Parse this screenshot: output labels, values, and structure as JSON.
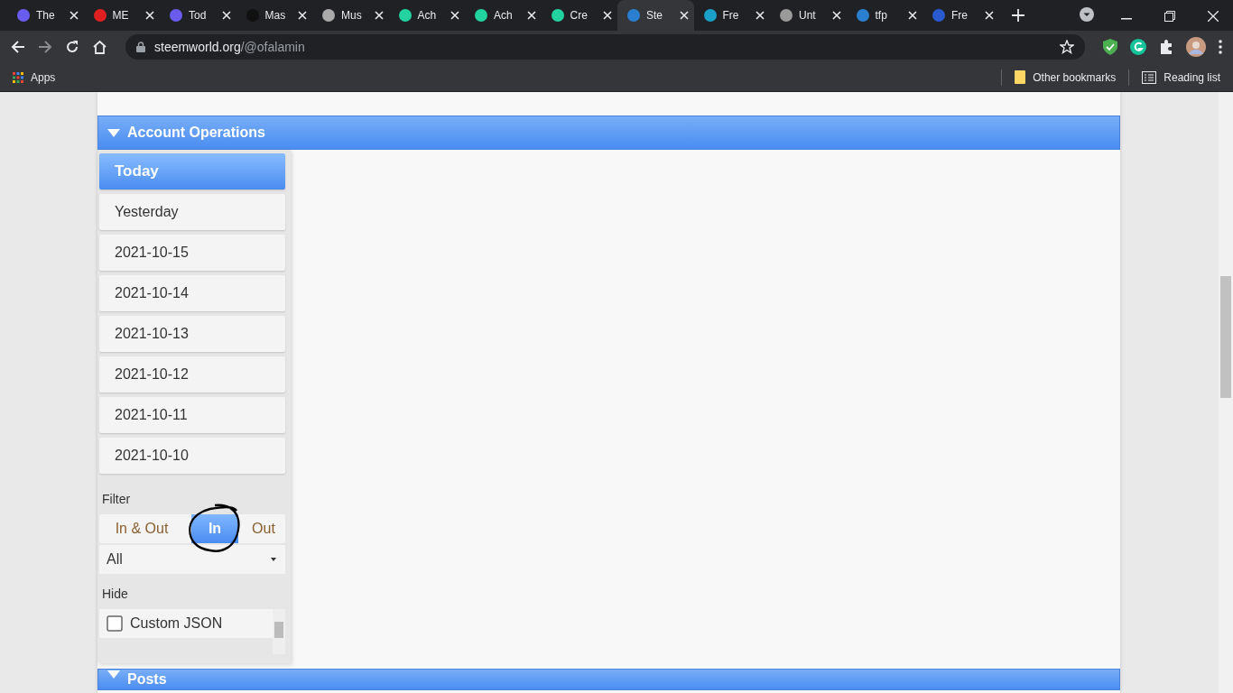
{
  "browser": {
    "tabs": [
      {
        "title": "The",
        "selected": false
      },
      {
        "title": "ME",
        "selected": false
      },
      {
        "title": "Tod",
        "selected": false
      },
      {
        "title": "Mas",
        "selected": false
      },
      {
        "title": "Mus",
        "selected": false
      },
      {
        "title": "Ach",
        "selected": false
      },
      {
        "title": "Ach",
        "selected": false
      },
      {
        "title": "Cre",
        "selected": false
      },
      {
        "title": "Ste",
        "selected": true
      },
      {
        "title": "Fre",
        "selected": false
      },
      {
        "title": "Unt",
        "selected": false
      },
      {
        "title": "tfp",
        "selected": false
      },
      {
        "title": "Fre",
        "selected": false
      }
    ],
    "url_host": "steemworld.org",
    "url_path": "/@ofalamin",
    "bookmarks": [
      {
        "label": "Apps"
      }
    ],
    "bookmarks_right": [
      {
        "label": "Other bookmarks"
      },
      {
        "label": "Reading list"
      }
    ]
  },
  "section": {
    "title": "Account Operations",
    "expanded": true
  },
  "days": [
    {
      "label": "Today",
      "selected": true
    },
    {
      "label": "Yesterday",
      "selected": false
    },
    {
      "label": "2021-10-15",
      "selected": false
    },
    {
      "label": "2021-10-14",
      "selected": false
    },
    {
      "label": "2021-10-13",
      "selected": false
    },
    {
      "label": "2021-10-12",
      "selected": false
    },
    {
      "label": "2021-10-11",
      "selected": false
    },
    {
      "label": "2021-10-10",
      "selected": false
    }
  ],
  "filter": {
    "label": "Filter",
    "options": [
      {
        "label": "In & Out",
        "selected": false
      },
      {
        "label": "In",
        "selected": true
      },
      {
        "label": "Out",
        "selected": false
      }
    ],
    "select_value": "All"
  },
  "hide": {
    "label": "Hide",
    "items": [
      {
        "label": "Custom JSON",
        "checked": false
      }
    ]
  },
  "next_section": {
    "title": "Posts",
    "expanded": true
  }
}
